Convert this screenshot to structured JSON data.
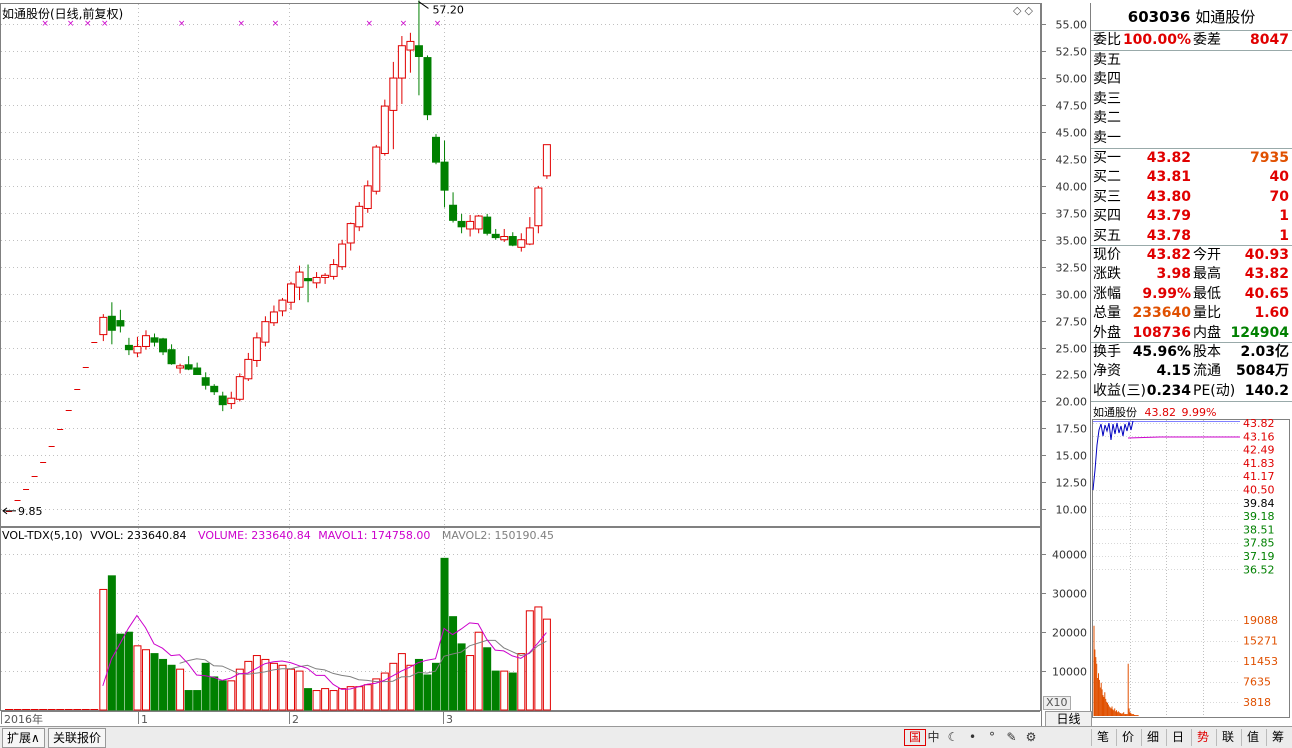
{
  "chart": {
    "title": "如通股份(日线,前复权)",
    "price_axis_ticks": [
      "55.00",
      "52.50",
      "50.00",
      "47.50",
      "45.00",
      "42.50",
      "40.00",
      "37.50",
      "35.00",
      "32.50",
      "30.00",
      "27.50",
      "25.00",
      "22.50",
      "20.00",
      "17.50",
      "15.00",
      "12.50",
      "10.00"
    ],
    "high_annotation": "57.20",
    "low_annotation": "9.85",
    "date_labels": [
      "2016年",
      "1",
      "2",
      "3"
    ],
    "volume_axis_ticks": [
      "40000",
      "30000",
      "20000",
      "10000"
    ],
    "zoom_label": "X10",
    "period_button": "日线",
    "toolbar_diamonds": "◇◇"
  },
  "volume_legend": {
    "name": "VOL-TDX(5,10)",
    "vvol": "VVOL: 233640.84",
    "volume": "VOLUME: 233640.84",
    "mavol1": "MAVOL1: 174758.00",
    "mavol2": "MAVOL2: 150190.45"
  },
  "chart_data": {
    "type": "candlestick",
    "ohlc": [
      [
        9.85,
        9.85,
        9.85,
        9.85
      ],
      [
        10.84,
        10.84,
        10.84,
        10.84
      ],
      [
        11.92,
        11.92,
        11.92,
        11.92
      ],
      [
        13.11,
        13.11,
        13.11,
        13.11
      ],
      [
        14.42,
        14.42,
        14.42,
        14.42
      ],
      [
        15.86,
        15.86,
        15.86,
        15.86
      ],
      [
        17.45,
        17.45,
        17.45,
        17.45
      ],
      [
        19.2,
        19.2,
        19.2,
        19.2
      ],
      [
        21.12,
        21.12,
        21.12,
        21.12
      ],
      [
        23.23,
        23.23,
        23.23,
        23.23
      ],
      [
        25.55,
        25.55,
        25.55,
        25.55
      ],
      [
        26.2,
        28.1,
        25.6,
        27.8
      ],
      [
        27.9,
        29.2,
        25.3,
        26.6
      ],
      [
        27.5,
        28.5,
        26.4,
        27.0
      ],
      [
        25.2,
        25.9,
        24.3,
        24.8
      ],
      [
        24.5,
        26.0,
        24.1,
        25.1
      ],
      [
        25.1,
        26.6,
        24.8,
        26.1
      ],
      [
        25.9,
        26.3,
        25.1,
        25.5
      ],
      [
        25.8,
        25.9,
        24.3,
        24.6
      ],
      [
        24.8,
        25.3,
        23.4,
        23.5
      ],
      [
        23.1,
        23.5,
        22.6,
        23.3
      ],
      [
        23.4,
        24.2,
        22.9,
        23.0
      ],
      [
        23.1,
        23.6,
        22.6,
        22.5
      ],
      [
        22.2,
        22.7,
        21.1,
        21.5
      ],
      [
        21.4,
        21.6,
        20.6,
        20.9
      ],
      [
        20.5,
        20.9,
        19.1,
        19.7
      ],
      [
        19.8,
        20.9,
        19.3,
        20.3
      ],
      [
        20.2,
        22.6,
        20.0,
        22.3
      ],
      [
        22.1,
        24.5,
        21.9,
        23.9
      ],
      [
        23.8,
        26.4,
        23.2,
        25.9
      ],
      [
        25.5,
        27.9,
        25.1,
        27.4
      ],
      [
        27.3,
        28.9,
        27.0,
        28.3
      ],
      [
        28.4,
        29.6,
        27.9,
        29.4
      ],
      [
        29.2,
        31.1,
        28.5,
        30.9
      ],
      [
        30.6,
        32.6,
        29.4,
        32.0
      ],
      [
        31.4,
        32.7,
        29.2,
        31.2
      ],
      [
        31.0,
        32.0,
        30.5,
        31.5
      ],
      [
        31.5,
        31.9,
        30.9,
        31.7
      ],
      [
        31.6,
        33.2,
        31.3,
        32.7
      ],
      [
        32.5,
        35.0,
        32.2,
        34.6
      ],
      [
        34.7,
        36.6,
        34.0,
        36.5
      ],
      [
        36.2,
        38.5,
        35.8,
        38.1
      ],
      [
        37.9,
        40.5,
        37.5,
        40.0
      ],
      [
        39.5,
        43.8,
        39.2,
        43.6
      ],
      [
        43.0,
        48.0,
        42.8,
        47.4
      ],
      [
        47.0,
        51.5,
        43.4,
        50.0
      ],
      [
        50.0,
        53.9,
        47.6,
        53.0
      ],
      [
        52.6,
        54.2,
        50.5,
        53.4
      ],
      [
        53.0,
        57.2,
        48.4,
        52.0
      ],
      [
        51.9,
        52.1,
        46.1,
        46.6
      ],
      [
        44.5,
        44.8,
        42.0,
        42.2
      ],
      [
        42.2,
        44.2,
        38.0,
        39.6
      ],
      [
        38.2,
        39.4,
        36.6,
        36.8
      ],
      [
        36.7,
        37.4,
        35.6,
        36.2
      ],
      [
        36.0,
        37.3,
        35.3,
        36.7
      ],
      [
        36.0,
        37.3,
        35.6,
        37.2
      ],
      [
        37.1,
        37.4,
        35.4,
        35.6
      ],
      [
        35.5,
        36.0,
        35.0,
        35.2
      ],
      [
        35.0,
        36.0,
        34.8,
        35.3
      ],
      [
        35.3,
        35.7,
        34.4,
        34.5
      ],
      [
        34.3,
        35.6,
        33.9,
        35.0
      ],
      [
        34.6,
        37.1,
        34.5,
        36.1
      ],
      [
        36.3,
        40.0,
        35.6,
        39.8
      ],
      [
        40.93,
        43.82,
        40.65,
        43.82
      ]
    ],
    "volume": [
      0,
      0,
      0,
      0,
      0,
      0,
      0,
      0,
      0,
      0,
      0,
      31000,
      34500,
      19500,
      20000,
      16500,
      15500,
      14500,
      13000,
      11500,
      10500,
      5000,
      5000,
      12000,
      8500,
      7500,
      7500,
      10500,
      12500,
      14000,
      13000,
      12000,
      11500,
      10500,
      10000,
      5500,
      5000,
      5500,
      5000,
      5500,
      6000,
      6000,
      6500,
      8000,
      9500,
      12000,
      14500,
      11500,
      13000,
      9000,
      12000,
      39000,
      24000,
      17000,
      14000,
      20000,
      16000,
      10000,
      10000,
      9500,
      14500,
      25500,
      26500,
      23364
    ],
    "mavol1": [
      null,
      null,
      null,
      null,
      null,
      null,
      null,
      null,
      null,
      null,
      null,
      6200,
      13100,
      17000,
      21000,
      24300,
      21200,
      17000,
      15900,
      14000,
      14200,
      11900,
      9000,
      8800,
      8400,
      7600,
      8200,
      9300,
      9500,
      10700,
      11900,
      12400,
      12600,
      12200,
      11400,
      10700,
      8900,
      8900,
      6600,
      5300,
      5400,
      6000,
      6600,
      6900,
      7600,
      8800,
      10000,
      11000,
      12200,
      12800,
      13200,
      21000,
      19400,
      20800,
      22400,
      22200,
      18200,
      15400,
      15200,
      13900,
      13300,
      14700,
      17200,
      19900
    ],
    "mavol2": [
      null,
      null,
      null,
      null,
      null,
      null,
      null,
      null,
      null,
      null,
      null,
      null,
      null,
      null,
      null,
      null,
      null,
      null,
      null,
      null,
      12000,
      12700,
      13200,
      12900,
      11400,
      11300,
      10300,
      9300,
      9200,
      9500,
      9800,
      10300,
      10600,
      10600,
      11100,
      11500,
      10600,
      10300,
      9400,
      8900,
      8600,
      7800,
      7600,
      7300,
      7300,
      7400,
      8500,
      8600,
      9700,
      9500,
      10000,
      13800,
      14400,
      14900,
      16500,
      17200,
      17900,
      17900,
      16000,
      15000,
      14000,
      14500,
      16500,
      17700
    ],
    "price_range": [
      9,
      56.5
    ],
    "volume_range": [
      0,
      45000
    ]
  },
  "quote": {
    "code": "603036",
    "name": "如通股份",
    "weibi_label": "委比",
    "weibi_value": "100.00%",
    "weicha_label": "委差",
    "weicha_value": "8047",
    "sell": [
      {
        "label": "卖五",
        "price": "",
        "vol": ""
      },
      {
        "label": "卖四",
        "price": "",
        "vol": ""
      },
      {
        "label": "卖三",
        "price": "",
        "vol": ""
      },
      {
        "label": "卖二",
        "price": "",
        "vol": ""
      },
      {
        "label": "卖一",
        "price": "",
        "vol": ""
      }
    ],
    "buy": [
      {
        "label": "买一",
        "price": "43.82",
        "vol": "7935"
      },
      {
        "label": "买二",
        "price": "43.81",
        "vol": "40"
      },
      {
        "label": "买三",
        "price": "43.80",
        "vol": "70"
      },
      {
        "label": "买四",
        "price": "43.79",
        "vol": "1"
      },
      {
        "label": "买五",
        "price": "43.78",
        "vol": "1"
      }
    ],
    "stats": [
      {
        "l1": "现价",
        "v1": "43.82",
        "c1": "red",
        "l2": "今开",
        "v2": "40.93",
        "c2": "red"
      },
      {
        "l1": "涨跌",
        "v1": "3.98",
        "c1": "red",
        "l2": "最高",
        "v2": "43.82",
        "c2": "red"
      },
      {
        "l1": "涨幅",
        "v1": "9.99%",
        "c1": "red",
        "l2": "最低",
        "v2": "40.65",
        "c2": "red"
      },
      {
        "l1": "总量",
        "v1": "233640",
        "c1": "orange",
        "l2": "量比",
        "v2": "1.60",
        "c2": "red"
      },
      {
        "l1": "外盘",
        "v1": "108736",
        "c1": "red",
        "l2": "内盘",
        "v2": "124904",
        "c2": "green"
      }
    ],
    "fundamentals": [
      {
        "l1": "换手",
        "v1": "45.96%",
        "l2": "股本",
        "v2": "2.03亿"
      },
      {
        "l1": "净资",
        "v1": "4.15",
        "l2": "流通",
        "v2": "5084万"
      },
      {
        "l1": "收益(三)",
        "v1": "0.234",
        "l2": "PE(动)",
        "v2": "140.2"
      }
    ]
  },
  "mini_chart": {
    "name": "如通股份",
    "price": "43.82",
    "pct": "9.99%",
    "price_ticks": [
      "43.82",
      "43.16",
      "42.49",
      "41.83",
      "41.17",
      "40.50",
      "39.84",
      "39.18",
      "38.51",
      "37.85",
      "37.19",
      "36.52"
    ],
    "volume_ticks": [
      "19088",
      "15271",
      "11453",
      "7635",
      "3818"
    ]
  },
  "bottom": {
    "tab_expand": "扩展∧",
    "tab_related": "关联报价",
    "right_tabs": [
      "笔",
      "价",
      "细",
      "日",
      "势",
      "联",
      "值",
      "筹"
    ],
    "active_tab": "势",
    "icons": [
      "国",
      "中",
      "☾",
      "•",
      "°",
      "✎",
      "⚙"
    ]
  },
  "colors": {
    "up": "#e00000",
    "down": "#008000",
    "mavol1": "#cc00cc",
    "mavol2": "#808080",
    "grid": "#c0c0c0",
    "axis": "#808080"
  }
}
